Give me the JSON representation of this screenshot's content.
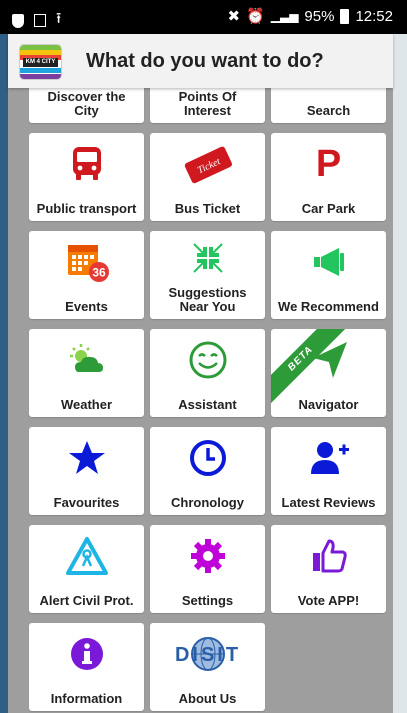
{
  "status": {
    "battery": "95%",
    "time": "12:52"
  },
  "app": {
    "logo_text": "KM 4 CITY",
    "title": "What do you want to do?"
  },
  "tiles": [
    {
      "label": "Discover the\nCity",
      "icon": "city-icon",
      "color": "#555"
    },
    {
      "label": "Points Of\nInterest",
      "icon": "poi-icon",
      "color": "#555"
    },
    {
      "label": "Search",
      "icon": "search-icon",
      "color": "#555"
    },
    {
      "label": "Public transport",
      "icon": "bus-icon",
      "color": "#d0191f"
    },
    {
      "label": "Bus Ticket",
      "icon": "ticket-icon",
      "color": "#d0191f",
      "icon_text": "Ticket"
    },
    {
      "label": "Car Park",
      "icon": "parking-icon",
      "color": "#d0191f",
      "icon_text": "P"
    },
    {
      "label": "Events",
      "icon": "calendar-icon",
      "color": "#f57c00",
      "badge": "36"
    },
    {
      "label": "Suggestions\nNear You",
      "icon": "compress-icon",
      "color": "#22c55e"
    },
    {
      "label": "We Recommend",
      "icon": "megaphone-icon",
      "color": "#22c55e"
    },
    {
      "label": "Weather",
      "icon": "weather-icon",
      "color": "#2e9b39"
    },
    {
      "label": "Assistant",
      "icon": "smiley-icon",
      "color": "#2e9b39"
    },
    {
      "label": "Navigator",
      "icon": "navigation-icon",
      "color": "#2e9b39",
      "ribbon": "BETA"
    },
    {
      "label": "Favourites",
      "icon": "star-icon",
      "color": "#0a1ad6"
    },
    {
      "label": "Chronology",
      "icon": "clock-icon",
      "color": "#0a1ad6"
    },
    {
      "label": "Latest Reviews",
      "icon": "add-user-icon",
      "color": "#0a1ad6"
    },
    {
      "label": "Alert Civil Prot.",
      "icon": "warning-icon",
      "color": "#1cb5e6"
    },
    {
      "label": "Settings",
      "icon": "gear-icon",
      "color": "#c000d8"
    },
    {
      "label": "Vote APP!",
      "icon": "thumbs-up-icon",
      "color": "#7a19d8"
    },
    {
      "label": "Information",
      "icon": "info-icon",
      "color": "#7a19d8"
    },
    {
      "label": "About Us",
      "icon": "disit-logo-icon",
      "color": "#2a5fa8",
      "icon_text": "DISIT"
    }
  ]
}
